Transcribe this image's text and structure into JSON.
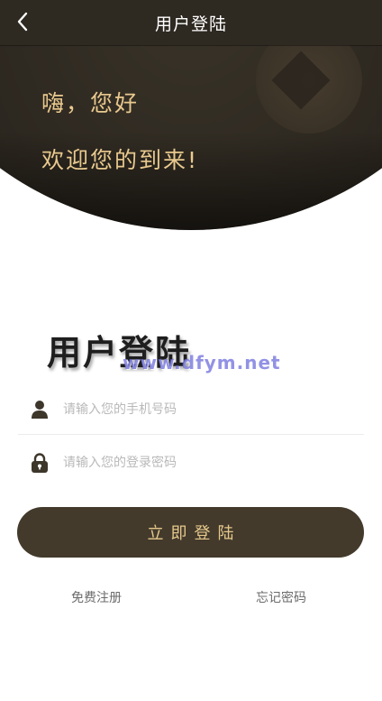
{
  "header": {
    "title": "用户登陆",
    "back_icon": "chevron-left-icon"
  },
  "hero": {
    "greeting_line1": "嗨，您好",
    "greeting_line2": "欢迎您的到来!",
    "decoration_icon": "coin-icon"
  },
  "main": {
    "title": "用户登陆",
    "watermark": "www.dfym.net"
  },
  "form": {
    "phone": {
      "placeholder": "请输入您的手机号码",
      "value": "",
      "icon": "user-icon"
    },
    "password": {
      "placeholder": "请输入您的登录密码",
      "value": "",
      "icon": "lock-icon"
    },
    "submit_label": "立即登陆"
  },
  "links": {
    "register": "免费注册",
    "forgot": "忘记密码"
  },
  "colors": {
    "header_bg": "#2e2921",
    "accent_gold": "#e9c98e",
    "button_bg": "#433a2c",
    "icon_dark": "#3d362a"
  }
}
